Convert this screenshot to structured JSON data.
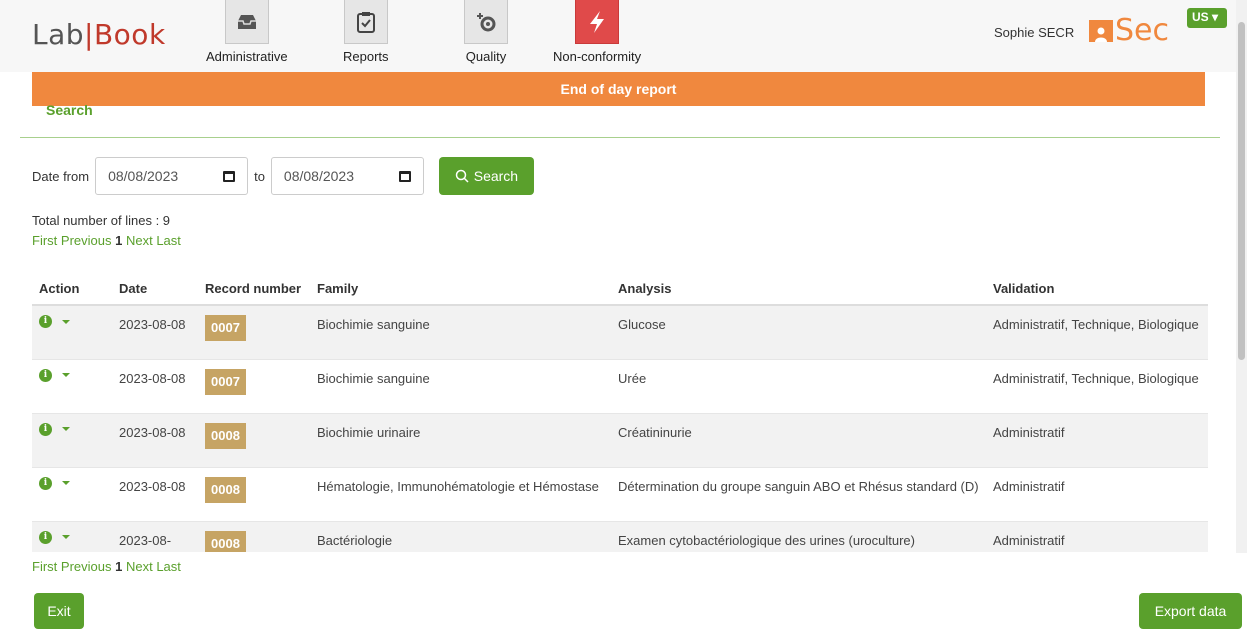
{
  "header": {
    "logo_left": "Lab",
    "logo_right": "Book",
    "nav": [
      {
        "label": "Administrative",
        "icon": "inbox-tray-icon"
      },
      {
        "label": "Reports",
        "icon": "clipboard-check-icon"
      },
      {
        "label": "Quality",
        "icon": "quality-gear-icon"
      },
      {
        "label": "Non-conformity",
        "icon": "lightning-icon"
      }
    ],
    "user_name": "Sophie SECR",
    "sec_logo": "Sec",
    "language": "US"
  },
  "banner": {
    "title": "End of day report"
  },
  "search_tab": "Search",
  "filter": {
    "date_from_label": "Date from",
    "date_from": "08/08/2023",
    "to_label": "to",
    "date_to": "08/08/2023",
    "search_button": "Search"
  },
  "total_lines": "Total number of lines : 9",
  "pager": {
    "first": "First",
    "previous": "Previous",
    "current": "1",
    "next": "Next",
    "last": "Last"
  },
  "table": {
    "headers": {
      "action": "Action",
      "date": "Date",
      "record": "Record number",
      "family": "Family",
      "analysis": "Analysis",
      "validation": "Validation"
    },
    "rows": [
      {
        "date": "2023-08-08",
        "record": "0007",
        "family": "Biochimie sanguine",
        "analysis": "Glucose",
        "validation": "Administratif, Technique, Biologique"
      },
      {
        "date": "2023-08-08",
        "record": "0007",
        "family": "Biochimie sanguine",
        "analysis": "Urée",
        "validation": "Administratif, Technique, Biologique"
      },
      {
        "date": "2023-08-08",
        "record": "0008",
        "family": "Biochimie urinaire",
        "analysis": "Créatininurie",
        "validation": "Administratif"
      },
      {
        "date": "2023-08-08",
        "record": "0008",
        "family": "Hématologie, Immunohématologie et Hémostase",
        "analysis": "Détermination du groupe sanguin ABO et Rhésus standard (D)",
        "validation": "Administratif"
      },
      {
        "date": "2023-08-",
        "record": "0008",
        "family": "Bactériologie",
        "analysis": "Examen cytobactériologique des urines (uroculture)",
        "validation": "Administratif"
      }
    ]
  },
  "footer": {
    "exit_button": "Exit",
    "export_button": "Export data"
  },
  "colors": {
    "accent_green": "#5aa02c",
    "banner_orange": "#f0883e",
    "record_badge": "#c6a464"
  }
}
